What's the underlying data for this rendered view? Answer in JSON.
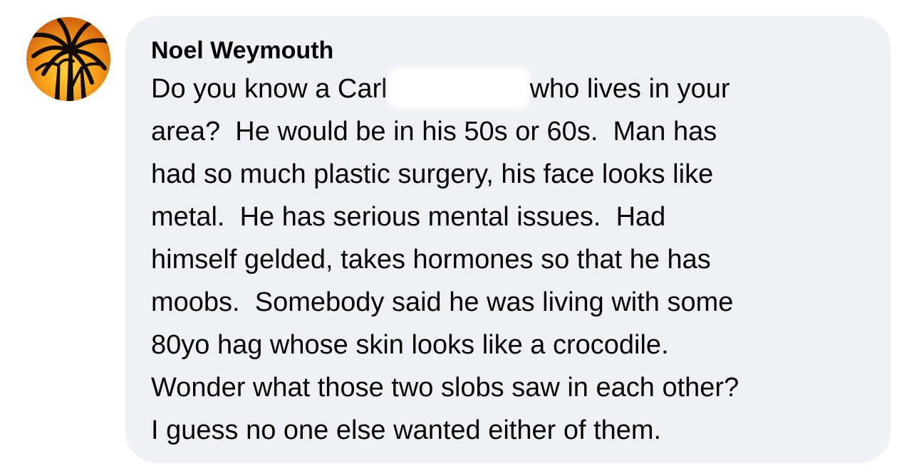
{
  "comment": {
    "author_name": "Noel Weymouth",
    "avatar_icon": "palm-tree-sunset-avatar",
    "bubble_color": "#eff1f6",
    "lines": {
      "l1a": "Do you know a Carl",
      "l1b": "who lives in your",
      "l2": "area?  He would be in his 50s or 60s.  Man has",
      "l3": "had so much plastic surgery, his face looks like",
      "l4": "metal.  He has serious mental issues.  Had",
      "l5": "himself gelded, takes hormones so that he has",
      "l6": "moobs.  Somebody said he was living with some",
      "l7": "80yo hag whose skin looks like a crocodile.",
      "l8": "Wonder what those two slobs saw in each other?",
      "l9": "I guess no one else wanted either of them."
    }
  }
}
